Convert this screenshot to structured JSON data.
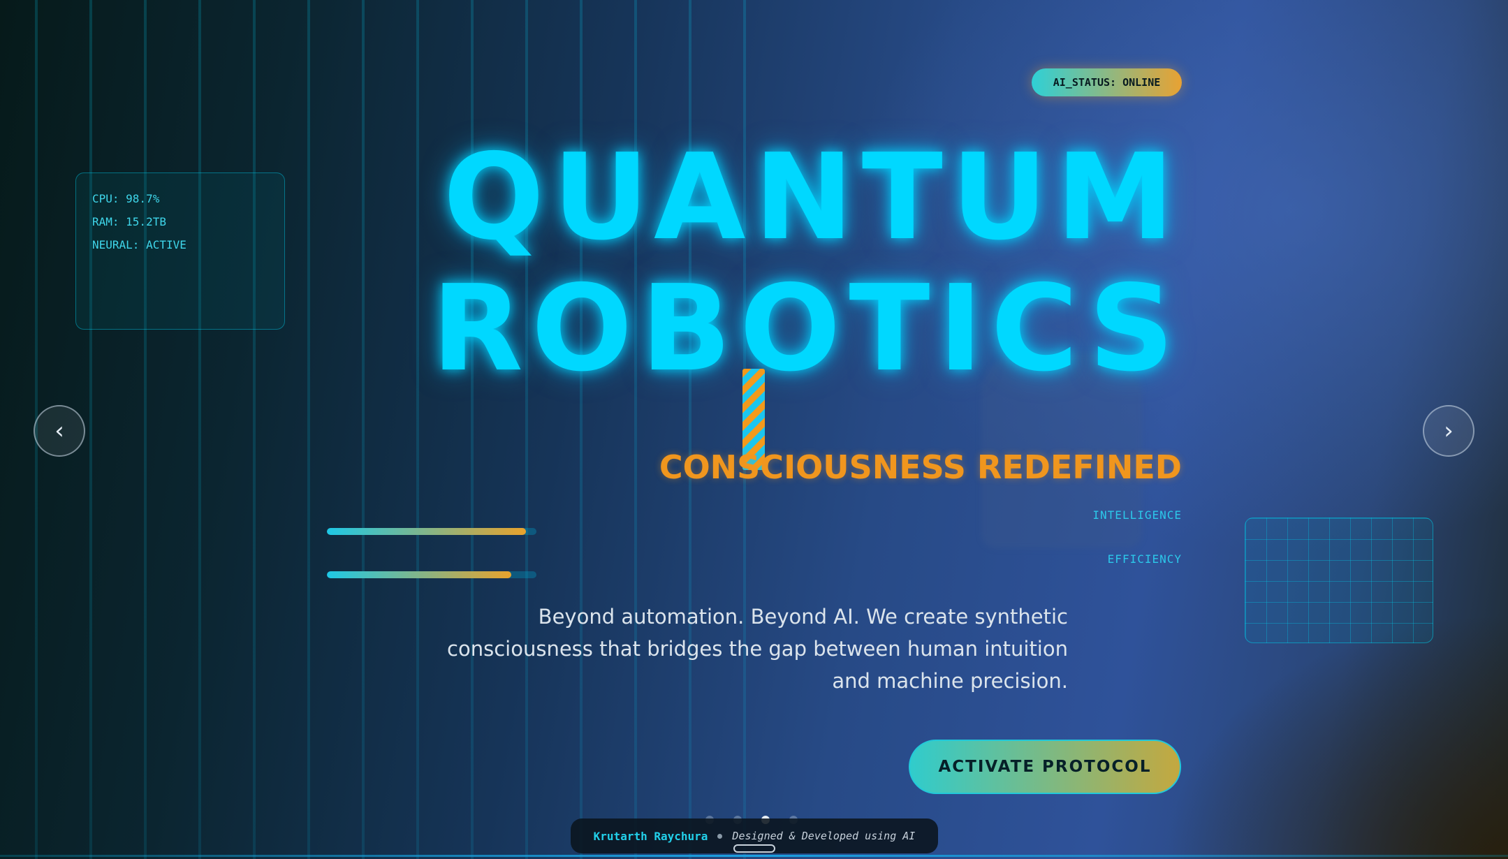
{
  "status": {
    "text": "AI_STATUS: ONLINE"
  },
  "stats": [
    {
      "label": "CPU",
      "value": "98.7%",
      "text": "CPU: 98.7%"
    },
    {
      "label": "RAM",
      "value": "15.2TB",
      "text": "RAM: 15.2TB"
    },
    {
      "label": "NEURAL",
      "value": "ACTIVE",
      "text": "NEURAL: ACTIVE"
    }
  ],
  "hero": {
    "title_line1": "QUANTUM",
    "title_line2": "ROBOTICS",
    "subtitle": "CONSCIOUSNESS REDEFINED",
    "description": "Beyond automation. Beyond AI. We create synthetic consciousness that bridges the gap between human intuition and machine precision."
  },
  "metrics": [
    {
      "label": "INTELLIGENCE",
      "level": 0.95
    },
    {
      "label": "EFFICIENCY",
      "level": 0.88
    }
  ],
  "cta": {
    "label": "ACTIVATE PROTOCOL"
  },
  "carousel": {
    "prev_label": "‹",
    "next_label": "›",
    "slide_count": 4,
    "active_index": 2
  },
  "footer": {
    "author": "Krutarth Raychura",
    "credit": "Designed & Developed using AI"
  },
  "colors": {
    "accent_cyan": "#00d8ff",
    "accent_orange": "#f0961e"
  }
}
